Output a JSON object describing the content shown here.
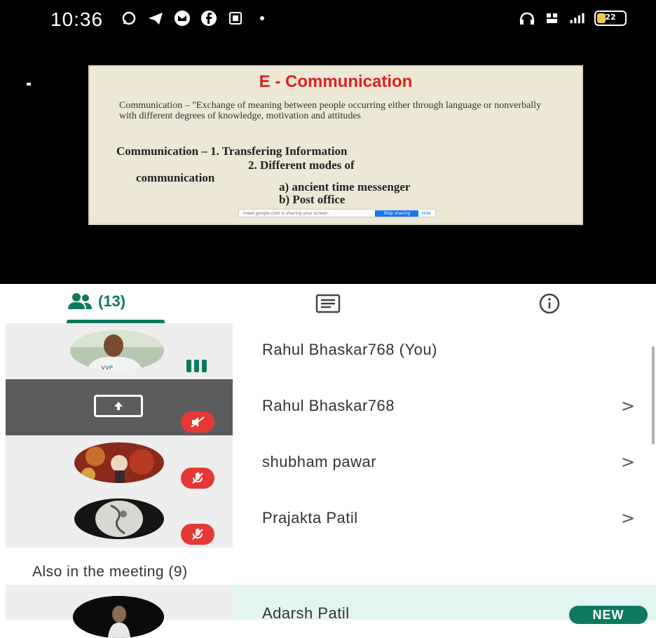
{
  "status_bar": {
    "time": "10:36",
    "battery_level": "22",
    "left_icons": [
      "whatsapp-icon",
      "telegram-icon",
      "mail-icon",
      "facebook-icon",
      "sim-icon"
    ],
    "right_icons": [
      "headset-icon",
      "volte-icon",
      "signal-icon"
    ]
  },
  "slide": {
    "title": "E - Communication",
    "definition": "Communication – \"Exchange of meaning between people occurring either through language or nonverbally with different degrees of knowledge, motivation and attitudes",
    "line1": "Communication –  1. Transfering Information",
    "line2": "2. Different modes of",
    "line3": "communication",
    "line4": "a) ancient time messenger",
    "line5": "b) Post office",
    "share_bar": {
      "text": "meet.google.com is sharing your screen.",
      "stop": "Stop sharing",
      "hide": "Hide"
    }
  },
  "tabs": {
    "people_count": "(13)",
    "icons": [
      "people-icon",
      "chat-icon",
      "info-icon"
    ],
    "accent": "#0d7a5f"
  },
  "participants": [
    {
      "name": "Rahul Bhaskar768 (You)",
      "status": "speaking",
      "chevron": ""
    },
    {
      "name": "Rahul Bhaskar768",
      "status": "presenting-muted",
      "chevron": ">"
    },
    {
      "name": "shubham pawar",
      "status": "muted",
      "chevron": ">"
    },
    {
      "name": "Prajakta Patil",
      "status": "muted",
      "chevron": ">"
    }
  ],
  "also_in_meeting": {
    "heading": "Also in the meeting (9)",
    "first": {
      "name": "Adarsh Patil",
      "badge": "NEW"
    }
  },
  "colors": {
    "mute_red": "#e53935",
    "new_row_bg": "#e3f5f1"
  }
}
